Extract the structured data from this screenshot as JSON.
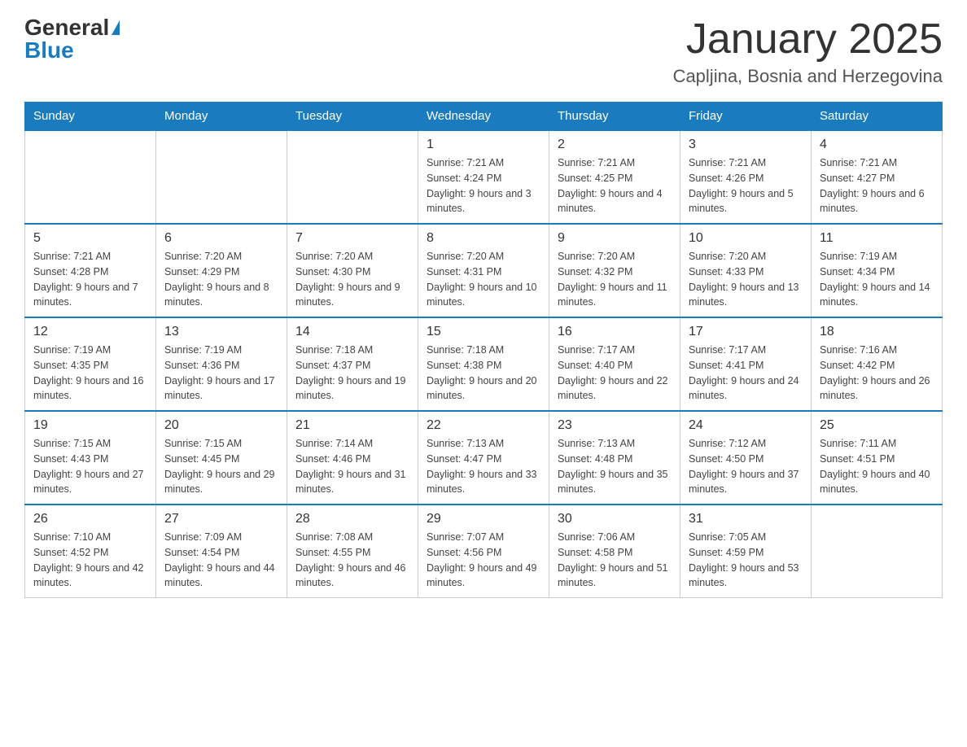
{
  "header": {
    "logo_general": "General",
    "logo_blue": "Blue",
    "month_title": "January 2025",
    "location": "Capljina, Bosnia and Herzegovina"
  },
  "days_of_week": [
    "Sunday",
    "Monday",
    "Tuesday",
    "Wednesday",
    "Thursday",
    "Friday",
    "Saturday"
  ],
  "weeks": [
    [
      {
        "day": "",
        "info": ""
      },
      {
        "day": "",
        "info": ""
      },
      {
        "day": "",
        "info": ""
      },
      {
        "day": "1",
        "info": "Sunrise: 7:21 AM\nSunset: 4:24 PM\nDaylight: 9 hours and 3 minutes."
      },
      {
        "day": "2",
        "info": "Sunrise: 7:21 AM\nSunset: 4:25 PM\nDaylight: 9 hours and 4 minutes."
      },
      {
        "day": "3",
        "info": "Sunrise: 7:21 AM\nSunset: 4:26 PM\nDaylight: 9 hours and 5 minutes."
      },
      {
        "day": "4",
        "info": "Sunrise: 7:21 AM\nSunset: 4:27 PM\nDaylight: 9 hours and 6 minutes."
      }
    ],
    [
      {
        "day": "5",
        "info": "Sunrise: 7:21 AM\nSunset: 4:28 PM\nDaylight: 9 hours and 7 minutes."
      },
      {
        "day": "6",
        "info": "Sunrise: 7:20 AM\nSunset: 4:29 PM\nDaylight: 9 hours and 8 minutes."
      },
      {
        "day": "7",
        "info": "Sunrise: 7:20 AM\nSunset: 4:30 PM\nDaylight: 9 hours and 9 minutes."
      },
      {
        "day": "8",
        "info": "Sunrise: 7:20 AM\nSunset: 4:31 PM\nDaylight: 9 hours and 10 minutes."
      },
      {
        "day": "9",
        "info": "Sunrise: 7:20 AM\nSunset: 4:32 PM\nDaylight: 9 hours and 11 minutes."
      },
      {
        "day": "10",
        "info": "Sunrise: 7:20 AM\nSunset: 4:33 PM\nDaylight: 9 hours and 13 minutes."
      },
      {
        "day": "11",
        "info": "Sunrise: 7:19 AM\nSunset: 4:34 PM\nDaylight: 9 hours and 14 minutes."
      }
    ],
    [
      {
        "day": "12",
        "info": "Sunrise: 7:19 AM\nSunset: 4:35 PM\nDaylight: 9 hours and 16 minutes."
      },
      {
        "day": "13",
        "info": "Sunrise: 7:19 AM\nSunset: 4:36 PM\nDaylight: 9 hours and 17 minutes."
      },
      {
        "day": "14",
        "info": "Sunrise: 7:18 AM\nSunset: 4:37 PM\nDaylight: 9 hours and 19 minutes."
      },
      {
        "day": "15",
        "info": "Sunrise: 7:18 AM\nSunset: 4:38 PM\nDaylight: 9 hours and 20 minutes."
      },
      {
        "day": "16",
        "info": "Sunrise: 7:17 AM\nSunset: 4:40 PM\nDaylight: 9 hours and 22 minutes."
      },
      {
        "day": "17",
        "info": "Sunrise: 7:17 AM\nSunset: 4:41 PM\nDaylight: 9 hours and 24 minutes."
      },
      {
        "day": "18",
        "info": "Sunrise: 7:16 AM\nSunset: 4:42 PM\nDaylight: 9 hours and 26 minutes."
      }
    ],
    [
      {
        "day": "19",
        "info": "Sunrise: 7:15 AM\nSunset: 4:43 PM\nDaylight: 9 hours and 27 minutes."
      },
      {
        "day": "20",
        "info": "Sunrise: 7:15 AM\nSunset: 4:45 PM\nDaylight: 9 hours and 29 minutes."
      },
      {
        "day": "21",
        "info": "Sunrise: 7:14 AM\nSunset: 4:46 PM\nDaylight: 9 hours and 31 minutes."
      },
      {
        "day": "22",
        "info": "Sunrise: 7:13 AM\nSunset: 4:47 PM\nDaylight: 9 hours and 33 minutes."
      },
      {
        "day": "23",
        "info": "Sunrise: 7:13 AM\nSunset: 4:48 PM\nDaylight: 9 hours and 35 minutes."
      },
      {
        "day": "24",
        "info": "Sunrise: 7:12 AM\nSunset: 4:50 PM\nDaylight: 9 hours and 37 minutes."
      },
      {
        "day": "25",
        "info": "Sunrise: 7:11 AM\nSunset: 4:51 PM\nDaylight: 9 hours and 40 minutes."
      }
    ],
    [
      {
        "day": "26",
        "info": "Sunrise: 7:10 AM\nSunset: 4:52 PM\nDaylight: 9 hours and 42 minutes."
      },
      {
        "day": "27",
        "info": "Sunrise: 7:09 AM\nSunset: 4:54 PM\nDaylight: 9 hours and 44 minutes."
      },
      {
        "day": "28",
        "info": "Sunrise: 7:08 AM\nSunset: 4:55 PM\nDaylight: 9 hours and 46 minutes."
      },
      {
        "day": "29",
        "info": "Sunrise: 7:07 AM\nSunset: 4:56 PM\nDaylight: 9 hours and 49 minutes."
      },
      {
        "day": "30",
        "info": "Sunrise: 7:06 AM\nSunset: 4:58 PM\nDaylight: 9 hours and 51 minutes."
      },
      {
        "day": "31",
        "info": "Sunrise: 7:05 AM\nSunset: 4:59 PM\nDaylight: 9 hours and 53 minutes."
      },
      {
        "day": "",
        "info": ""
      }
    ]
  ]
}
